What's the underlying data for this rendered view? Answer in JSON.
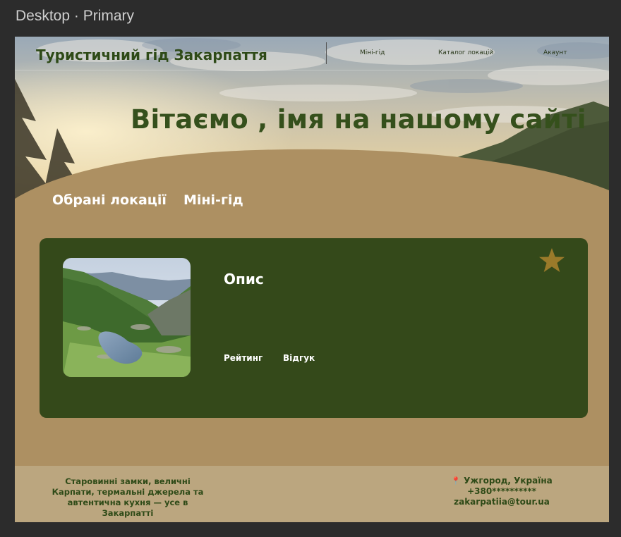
{
  "editor": {
    "frame_label": "Desktop · Primary"
  },
  "header": {
    "brand": "Туристичний гід Закарпаття",
    "nav": [
      {
        "label": "Міні-гід"
      },
      {
        "label": "Каталог локацій"
      },
      {
        "label": "Акаунт"
      }
    ]
  },
  "hero": {
    "title": "Вітаємо , імя на нашому сайті"
  },
  "tabs": [
    {
      "label": "Обрані локації"
    },
    {
      "label": "Міні-гід"
    }
  ],
  "card": {
    "title": "Опис",
    "rating_label": "Рейтинг",
    "review_label": "Відгук",
    "favorite_icon": "star-icon"
  },
  "footer": {
    "tagline": "Старовинні замки, величні Карпати, термальні джерела та автентична кухня — усе в Закарпатті",
    "location": "Ужгород, Україна",
    "phone": "+380**********",
    "email": "zakarpatiia@tour.ua",
    "location_icon": "map-pin-icon"
  },
  "colors": {
    "brand_green": "#2e4a17",
    "card_green": "#34491a",
    "sand": "#ad9062",
    "footer_sand": "#bba67f",
    "star_gold": "#9a7a2a"
  }
}
